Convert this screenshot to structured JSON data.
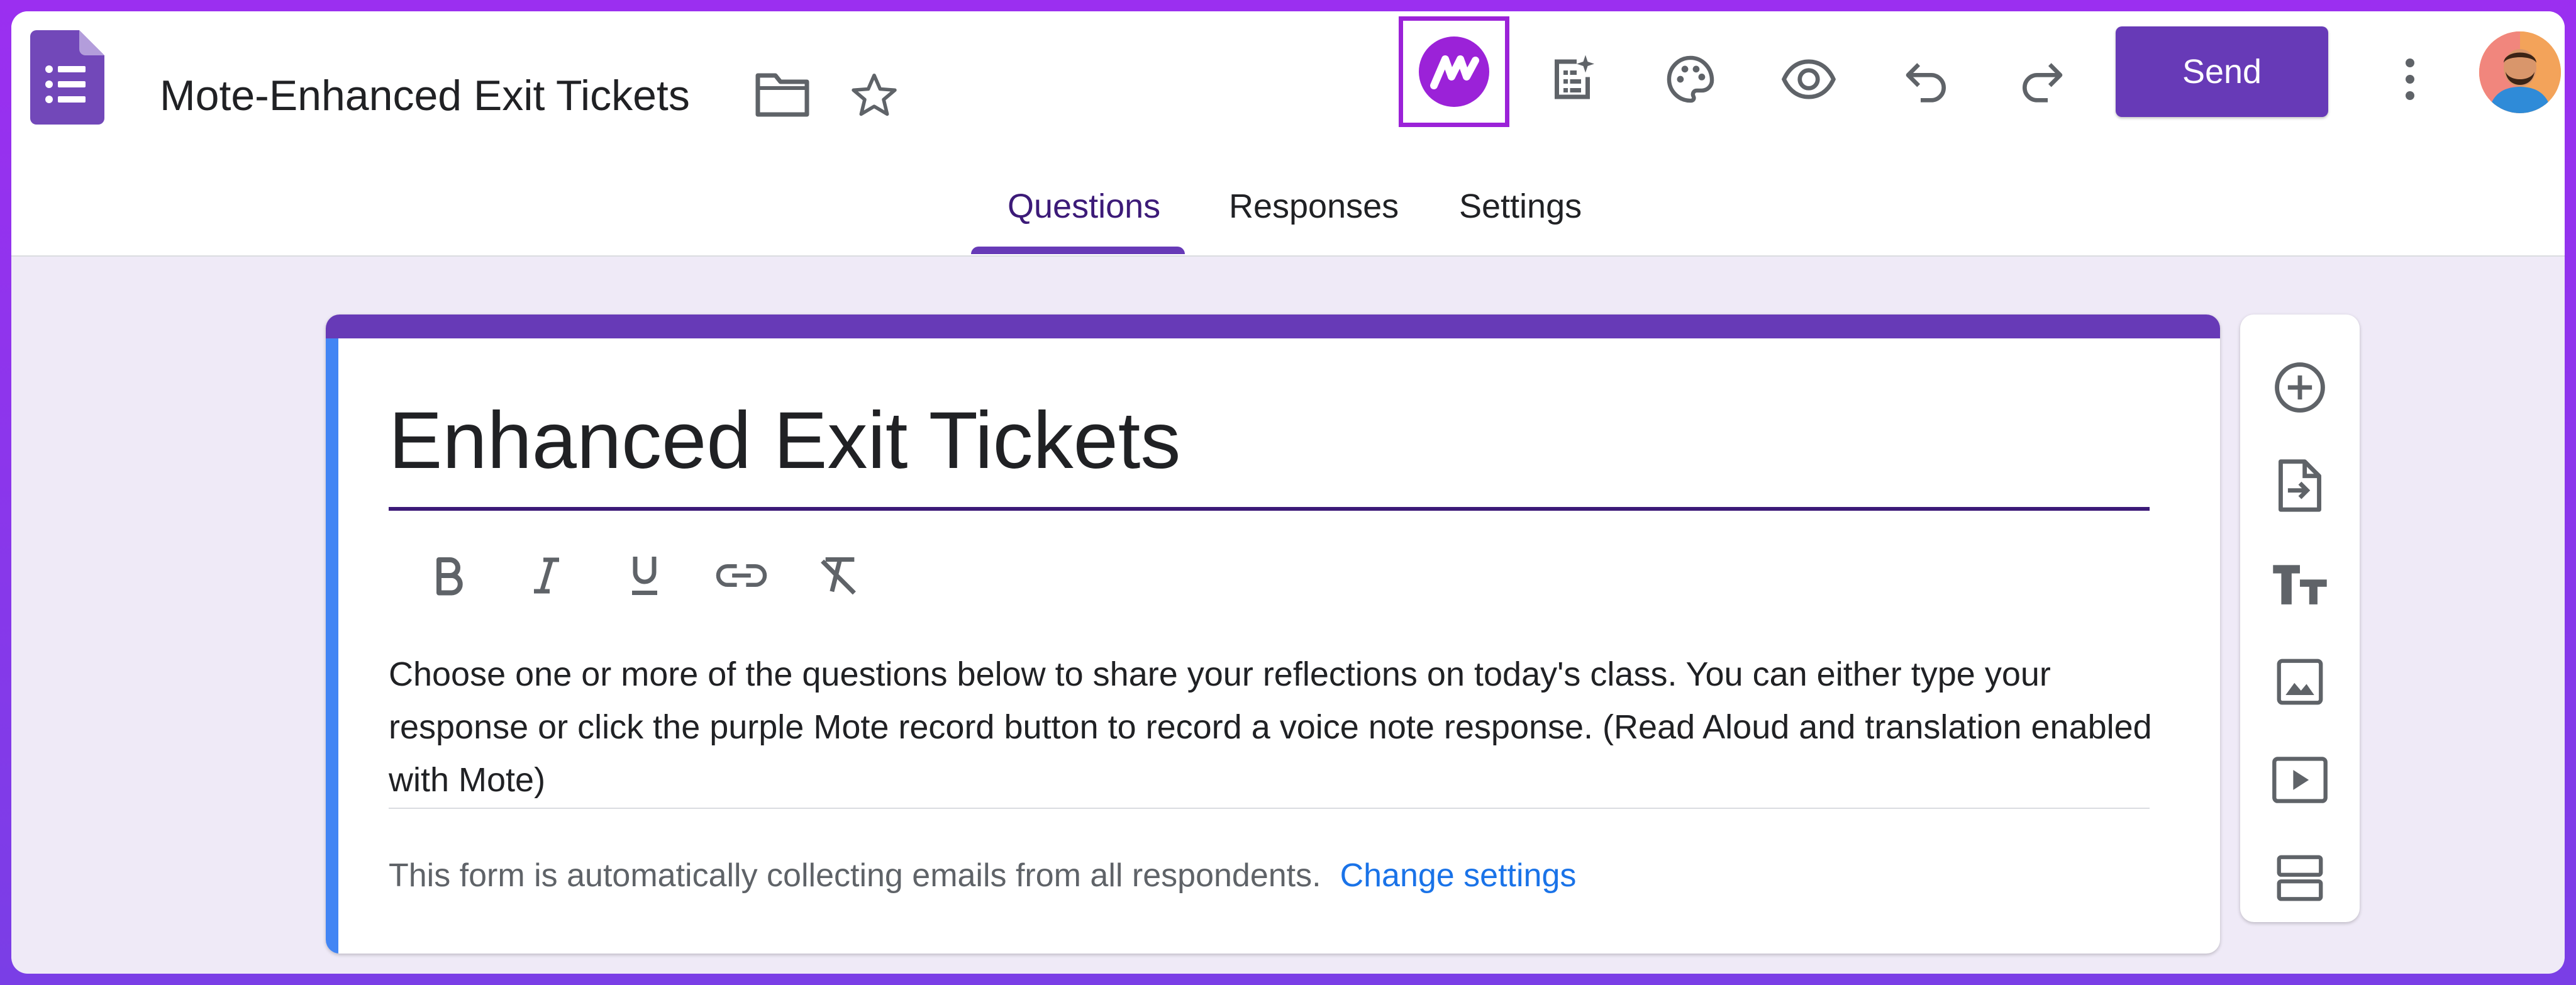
{
  "header": {
    "doc_title": "Mote-Enhanced Exit Tickets",
    "send_label": "Send",
    "icons": [
      "forms-logo-icon",
      "folder-icon",
      "star-icon",
      "mote-extension-icon",
      "quiz-ai-icon",
      "palette-icon",
      "preview-eye-icon",
      "undo-icon",
      "redo-icon",
      "more-vert-icon"
    ]
  },
  "tabs": [
    {
      "label": "Questions",
      "active": true
    },
    {
      "label": "Responses",
      "active": false
    },
    {
      "label": "Settings",
      "active": false
    }
  ],
  "form": {
    "title": "Enhanced Exit Tickets",
    "formatting_tools": [
      "bold-icon",
      "italic-icon",
      "underline-icon",
      "link-icon",
      "clear-format-icon"
    ],
    "description": "Choose one or more of the questions below to share your reflections on today's class. You can either type your response or click the purple Mote record button to record a voice note response. (Read Aloud and translation enabled with Mote)",
    "email_notice": "This form is automatically collecting emails from all respondents.",
    "change_settings_label": "Change settings"
  },
  "side_toolbar": [
    "add-question-icon",
    "import-questions-icon",
    "add-title-icon",
    "add-image-icon",
    "add-video-icon",
    "add-section-icon"
  ],
  "colors": {
    "theme_purple": "#673ab7",
    "frame_purple": "#9b2ff0",
    "mote_highlight": "#9b22d8",
    "title_accent": "#4285f4",
    "link_blue": "#1a73e8"
  }
}
